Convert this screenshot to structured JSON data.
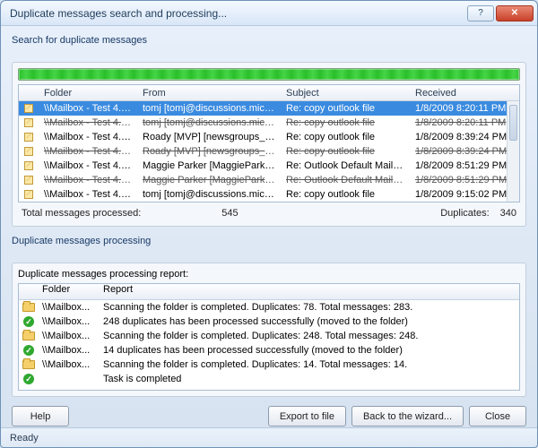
{
  "window": {
    "title": "Duplicate messages search and processing..."
  },
  "section": {
    "search_label": "Search for duplicate messages",
    "processing_label": "Duplicate messages processing",
    "report_label": "Duplicate messages processing report:"
  },
  "columns": {
    "folder": "Folder",
    "from": "From",
    "subject": "Subject",
    "received": "Received",
    "report_folder": "Folder",
    "report": "Report"
  },
  "messages": [
    {
      "sel": true,
      "strike": false,
      "folder": "\\\\Mailbox - Test 4. Us...",
      "from": "tomj [tomj@discussions.micros...",
      "subject": "Re: copy outlook file",
      "received": "1/8/2009 8:20:11 PM"
    },
    {
      "sel": false,
      "strike": true,
      "folder": "\\\\Mailbox - Test 4. Us...",
      "from": "tomj [tomj@discussions.micros...",
      "subject": "Re: copy outlook file",
      "received": "1/8/2009 8:20:11 PM"
    },
    {
      "sel": false,
      "strike": false,
      "folder": "\\\\Mailbox - Test 4. Us...",
      "from": "Roady [MVP] [newsgroups_DE...",
      "subject": "Re: copy outlook file",
      "received": "1/8/2009 8:39:24 PM"
    },
    {
      "sel": false,
      "strike": true,
      "folder": "\\\\Mailbox - Test 4. Us...",
      "from": "Roady [MVP] [newsgroups_DE...",
      "subject": "Re: copy outlook file",
      "received": "1/8/2009 8:39:24 PM"
    },
    {
      "sel": false,
      "strike": false,
      "folder": "\\\\Mailbox - Test 4. Us...",
      "from": "Maggie Parker [MaggieParker@...",
      "subject": "Re: Outlook Default Mail Acc...",
      "received": "1/8/2009 8:51:29 PM"
    },
    {
      "sel": false,
      "strike": true,
      "folder": "\\\\Mailbox - Test 4. Us...",
      "from": "Maggie Parker [MaggieParker@...",
      "subject": "Re: Outlook Default Mail Acc...",
      "received": "1/8/2009 8:51:29 PM"
    },
    {
      "sel": false,
      "strike": false,
      "folder": "\\\\Mailbox - Test 4. Us...",
      "from": "tomj [tomj@discussions.micros...",
      "subject": "Re: copy outlook file",
      "received": "1/8/2009 9:15:02 PM"
    }
  ],
  "stats": {
    "processed_label": "Total messages processed:",
    "processed_value": "545",
    "duplicates_label": "Duplicates:",
    "duplicates_value": "340"
  },
  "report_rows": [
    {
      "icon": "folder",
      "folder": "\\\\Mailbox...",
      "report": "Scanning the folder is completed. Duplicates: 78. Total messages: 283."
    },
    {
      "icon": "ok",
      "folder": "\\\\Mailbox...",
      "report": "248 duplicates has been processed successfully (moved to the folder)"
    },
    {
      "icon": "folder",
      "folder": "\\\\Mailbox...",
      "report": "Scanning the folder is completed. Duplicates: 248. Total messages: 248."
    },
    {
      "icon": "ok",
      "folder": "\\\\Mailbox...",
      "report": "14 duplicates has been processed successfully (moved to the folder)"
    },
    {
      "icon": "folder",
      "folder": "\\\\Mailbox...",
      "report": "Scanning the folder is completed. Duplicates: 14. Total messages: 14."
    },
    {
      "icon": "ok",
      "folder": "",
      "report": "Task is completed"
    }
  ],
  "buttons": {
    "help": "Help",
    "export": "Export to file",
    "back": "Back to the wizard...",
    "close": "Close"
  },
  "status": "Ready"
}
